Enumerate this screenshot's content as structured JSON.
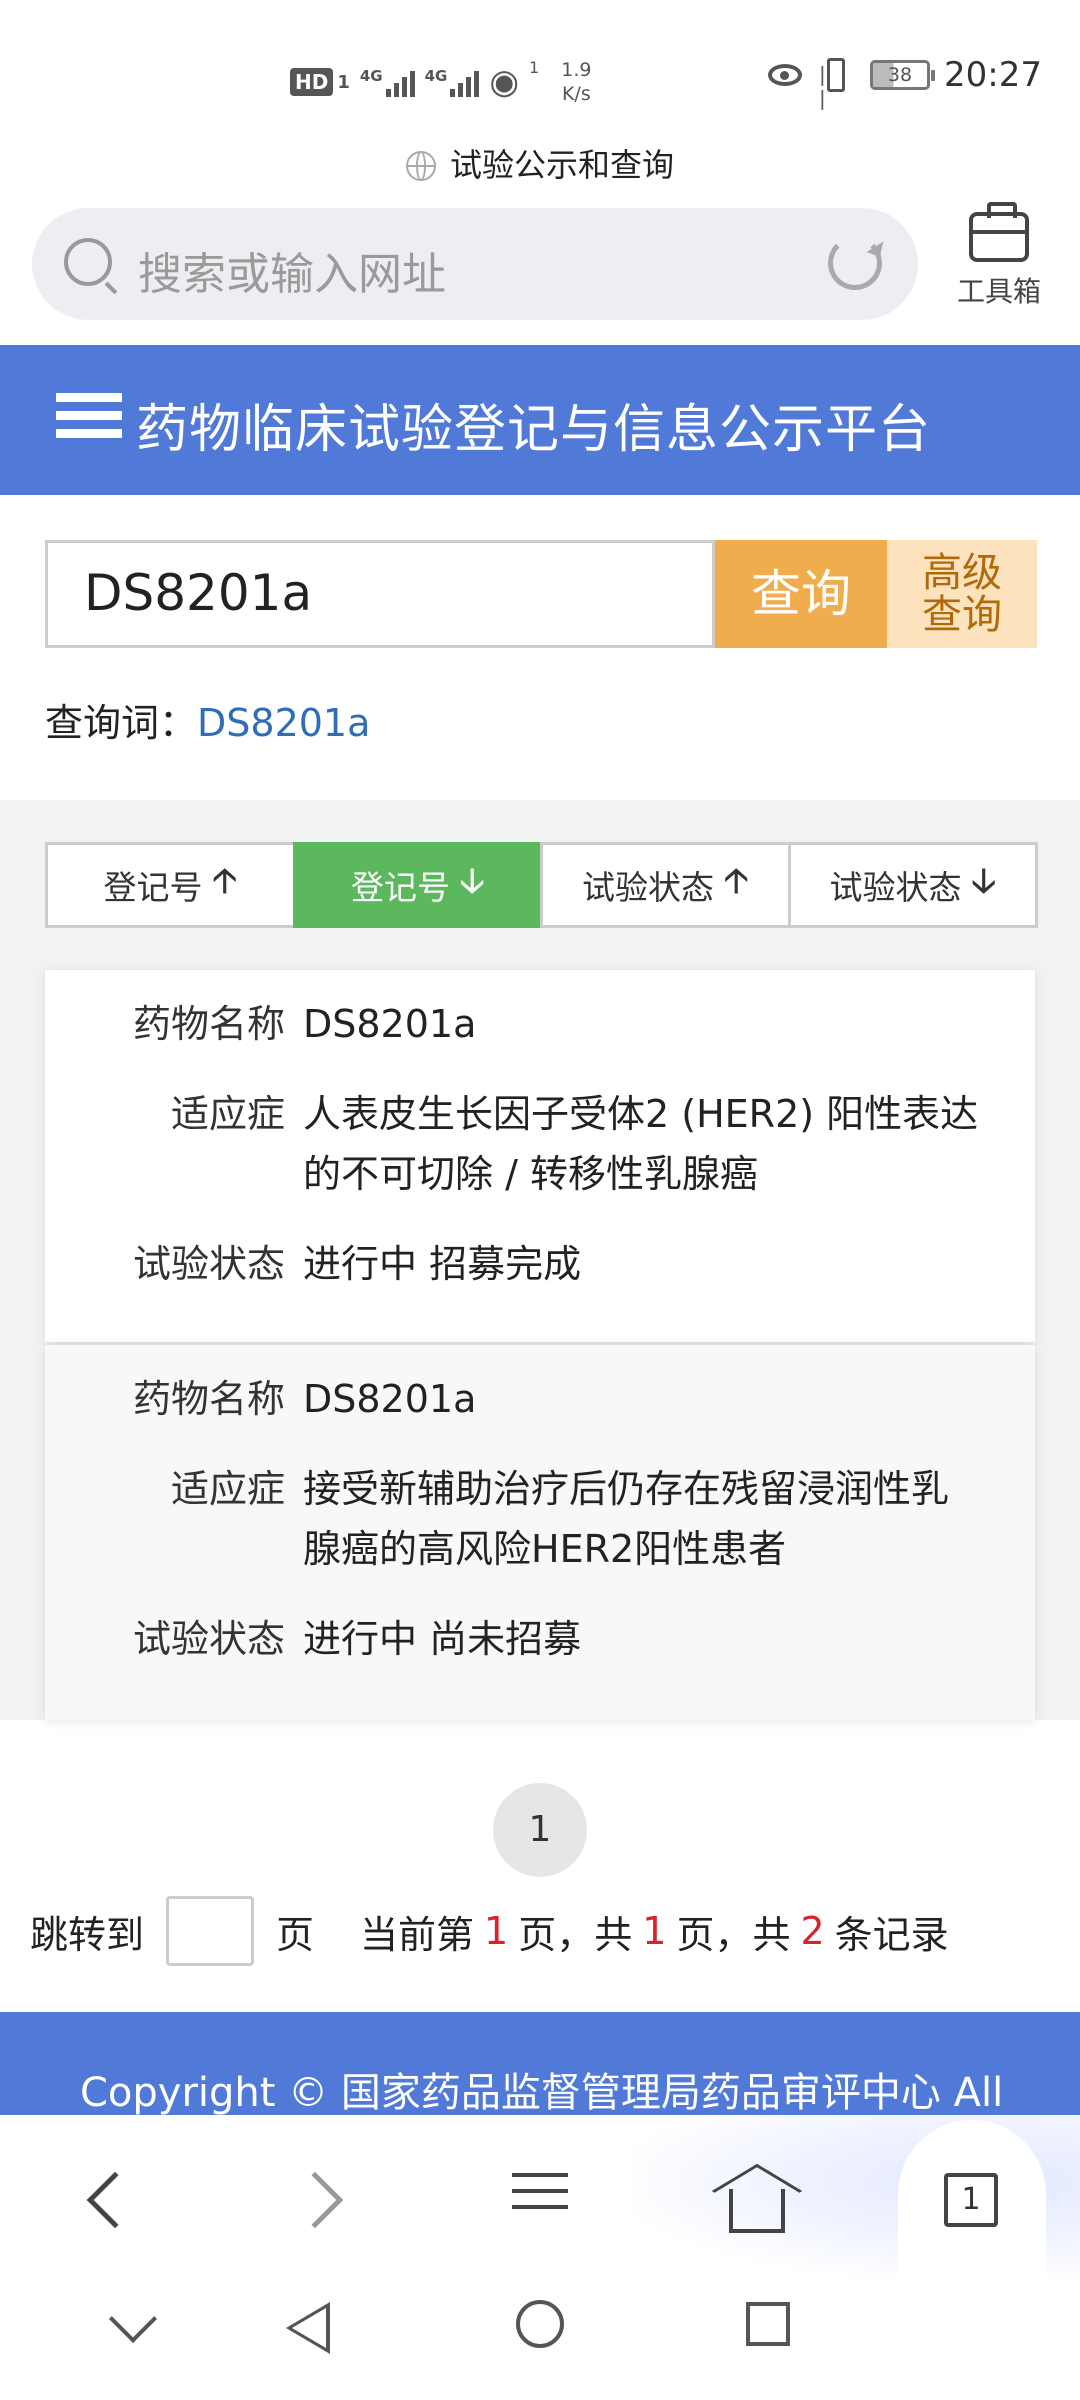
{
  "status_bar": {
    "hd": "HD",
    "sim": "1",
    "net1": "4G",
    "net2": "4G",
    "wifi_sub": "1",
    "speed_value": "1.9",
    "speed_unit": "K/s",
    "battery": "38",
    "time": "20:27"
  },
  "browser": {
    "page_title": "试验公示和查询",
    "search_placeholder": "搜索或输入网址",
    "toolbox_label": "工具箱",
    "tab_count": "1"
  },
  "site": {
    "title": "药物临床试验登记与信息公示平台"
  },
  "query": {
    "input_value": "DS8201a",
    "search_button": "查询",
    "advanced_line1": "高级",
    "advanced_line2": "查询",
    "term_label": "查询词：",
    "term_value": "DS8201a"
  },
  "sort_buttons": [
    {
      "label": "登记号",
      "arrow": "🡡"
    },
    {
      "label": "登记号",
      "arrow": "🡣"
    },
    {
      "label": "试验状态",
      "arrow": "🡡"
    },
    {
      "label": "试验状态",
      "arrow": "🡣"
    }
  ],
  "results": [
    {
      "drug_label": "药物名称",
      "drug": "DS8201a",
      "indication_label": "适应症",
      "indication_line1": "人表皮生长因子受体2 (HER2) 阳性表达",
      "indication_line2": "的不可切除 / 转移性乳腺癌",
      "status_label": "试验状态",
      "status": "进行中 招募完成"
    },
    {
      "drug_label": "药物名称",
      "drug": "DS8201a",
      "indication_label": "适应症",
      "indication_line1": "接受新辅助治疗后仍存在残留浸润性乳",
      "indication_line2": "腺癌的高风险HER2阳性患者",
      "status_label": "试验状态",
      "status": "进行中 尚未招募"
    }
  ],
  "pagination": {
    "current_page_bubble": "1",
    "jump_label": "跳转到",
    "page_unit": "页",
    "current_prefix": "当前第",
    "current_page": "1",
    "total_pages_prefix": "页，共",
    "total_pages": "1",
    "total_records_prefix": "页，共",
    "total_records": "2",
    "records_suffix": "条记录"
  },
  "footer": {
    "copyright": "Copyright © 国家药品监督管理局药品审评中心 All"
  }
}
